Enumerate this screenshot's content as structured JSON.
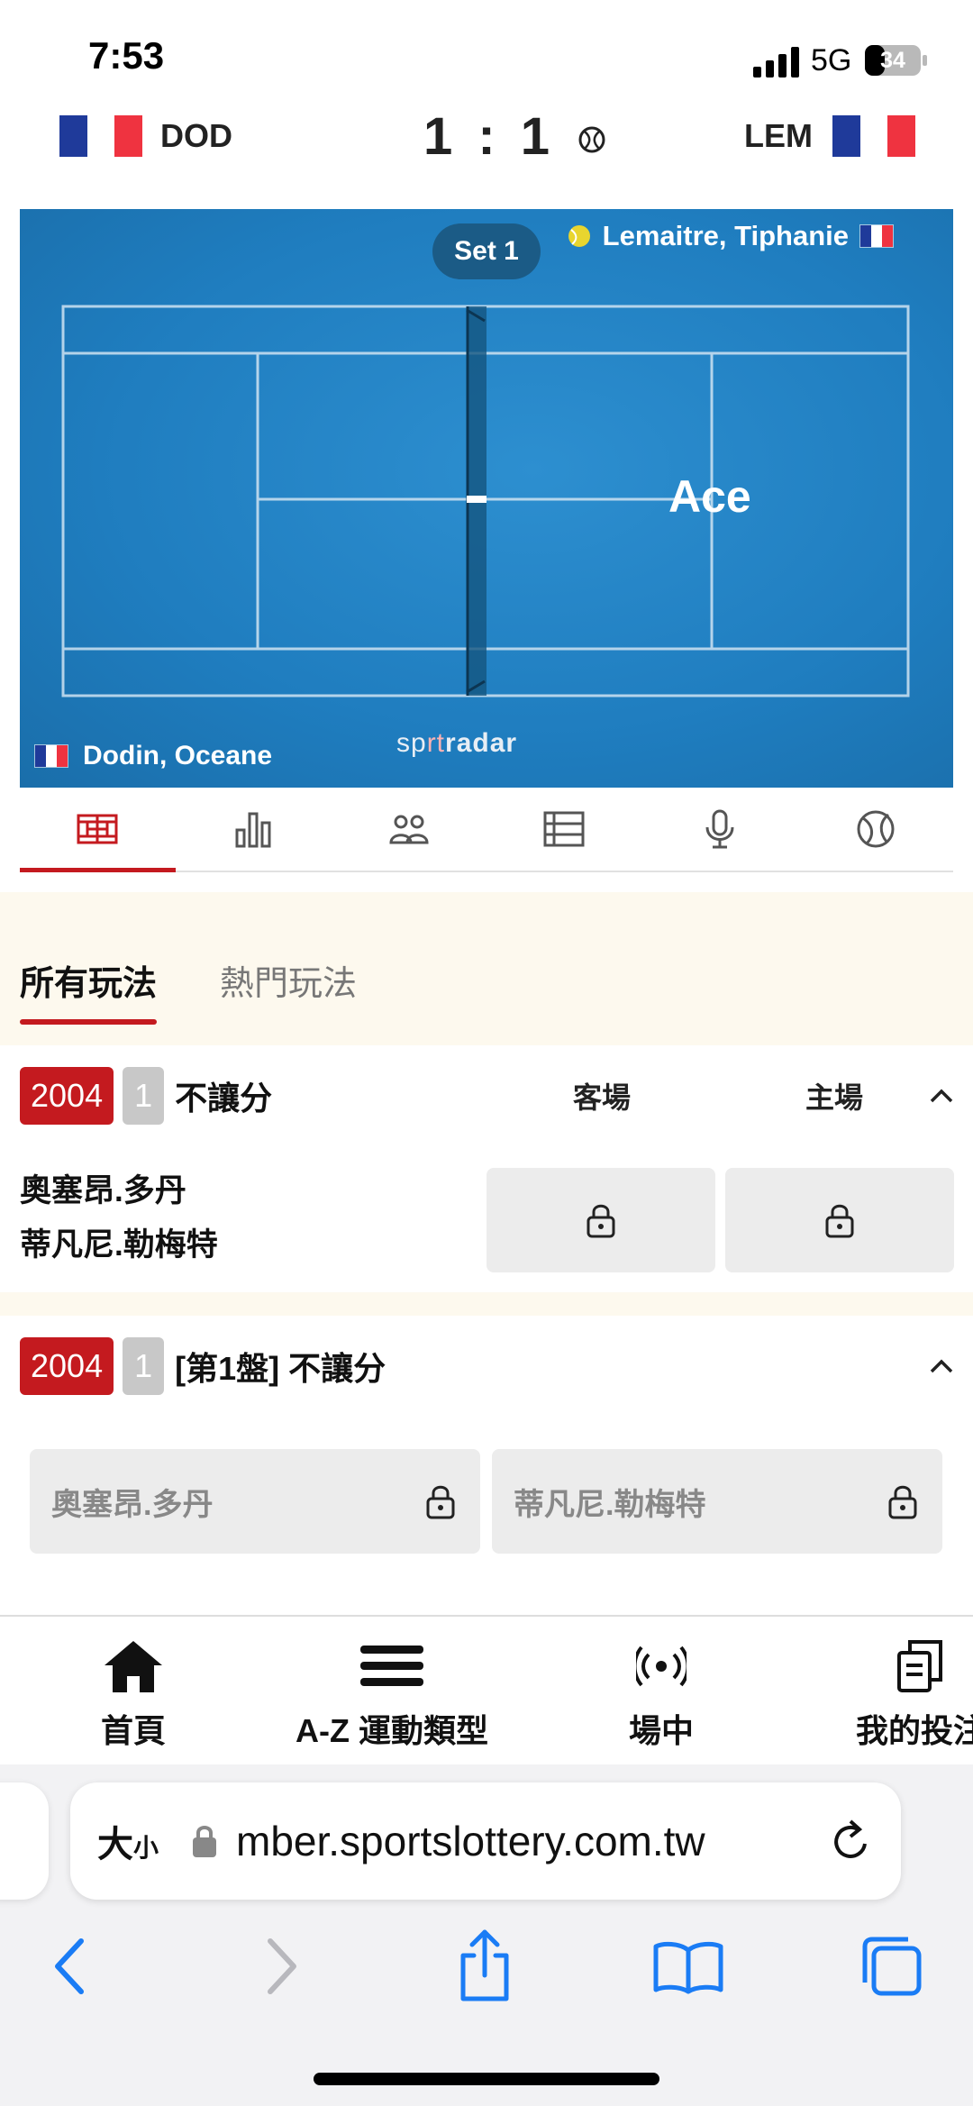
{
  "status_bar": {
    "time": "7:53",
    "network": "5G",
    "battery": "34"
  },
  "score_header": {
    "home_code": "DOD",
    "away_code": "LEM",
    "score": "1 : 1"
  },
  "court": {
    "set_label": "Set 1",
    "serving_player": "Lemaitre, Tiphanie",
    "other_player": "Dodin, Oceane",
    "event_text": "Ace",
    "provider_prefix": "sp",
    "provider_mid": "rt",
    "provider_suffix": "radar"
  },
  "tabs": [
    {
      "icon": "court-icon",
      "active": true
    },
    {
      "icon": "stats-icon"
    },
    {
      "icon": "lineup-icon"
    },
    {
      "icon": "list-icon"
    },
    {
      "icon": "microphone-icon"
    },
    {
      "icon": "tennis-ball-icon"
    }
  ],
  "filters": {
    "all": "所有玩法",
    "popular": "熱門玩法"
  },
  "market1": {
    "code": "2004",
    "num": "1",
    "title": "不讓分",
    "col_away": "客場",
    "col_home": "主場",
    "team1": "奧塞昂.多丹",
    "team2": "蒂凡尼.勒梅特"
  },
  "market2": {
    "code": "2004",
    "num": "1",
    "title": "[第1盤] 不讓分",
    "opt1": "奧塞昂.多丹",
    "opt2": "蒂凡尼.勒梅特"
  },
  "bottom_nav": {
    "home": "首頁",
    "sports": "A-Z 運動類型",
    "live": "場中",
    "bets": "我的投注"
  },
  "browser": {
    "text_size": "大",
    "text_size_small": "小",
    "url": "mber.sportslottery.com.tw"
  },
  "colors": {
    "accent": "#c41a1f",
    "court": "#1f7dbf",
    "ios_blue": "#1a7cf5"
  }
}
